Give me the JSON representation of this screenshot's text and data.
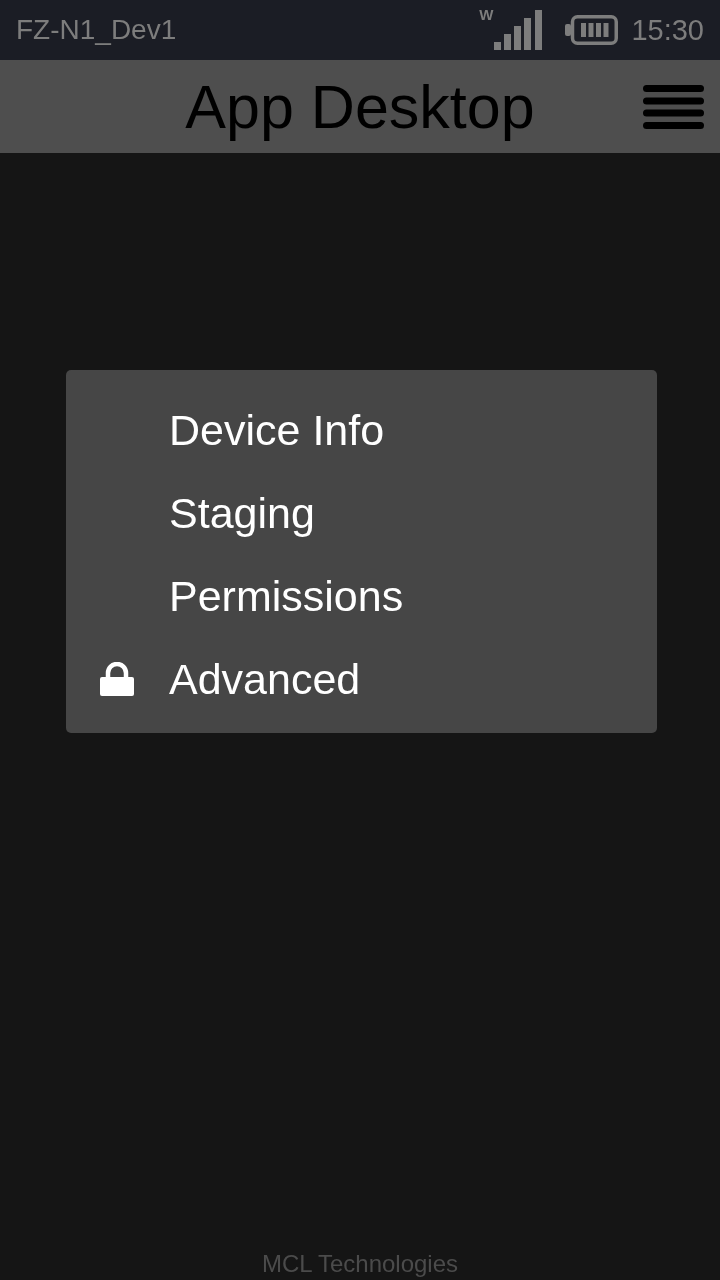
{
  "status_bar": {
    "device_name": "FZ-N1_Dev1",
    "network_type": "W",
    "time": "15:30"
  },
  "title_bar": {
    "title": "App Desktop"
  },
  "menu": {
    "items": [
      {
        "label": "Device Info",
        "locked": false
      },
      {
        "label": "Staging",
        "locked": false
      },
      {
        "label": "Permissions",
        "locked": false
      },
      {
        "label": "Advanced",
        "locked": true
      }
    ]
  },
  "footer": {
    "text": "MCL Technologies"
  }
}
